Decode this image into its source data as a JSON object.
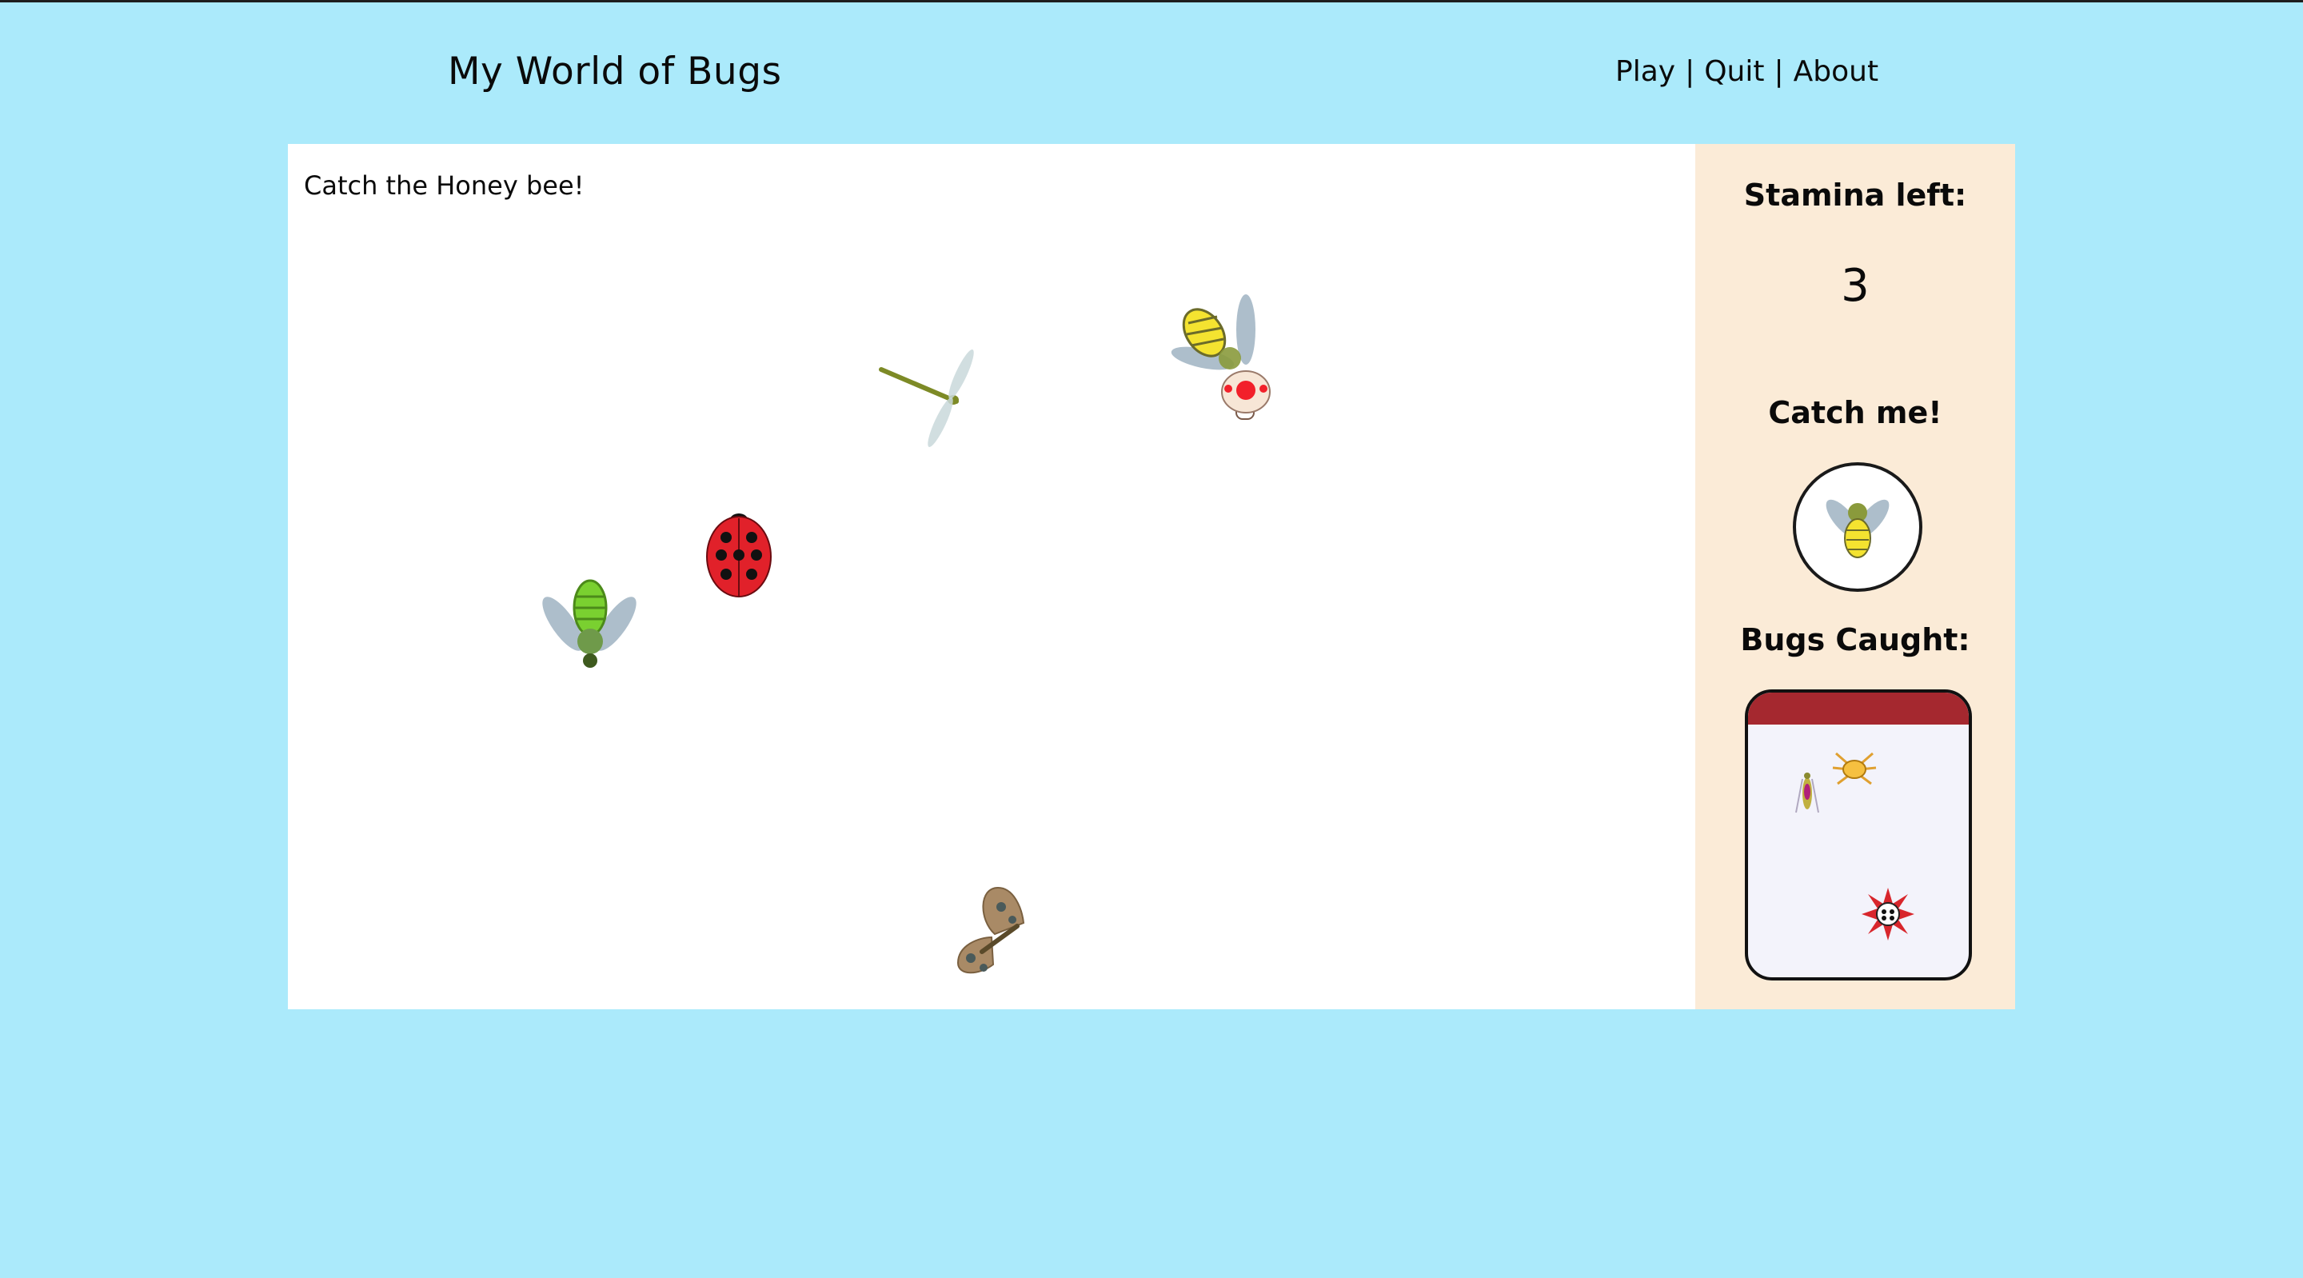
{
  "header": {
    "title": "My World of Bugs",
    "nav": [
      {
        "label": "Play"
      },
      {
        "label": "Quit"
      },
      {
        "label": "About"
      }
    ],
    "separator": "|"
  },
  "game": {
    "instruction": "Catch the Honey bee!",
    "bugs": [
      {
        "name": "dragonfly-icon"
      },
      {
        "name": "honey-bee-icon"
      },
      {
        "name": "mushroom-icon"
      },
      {
        "name": "ladybug-icon"
      },
      {
        "name": "green-fly-icon"
      },
      {
        "name": "butterfly-icon"
      }
    ]
  },
  "side": {
    "stamina_label": "Stamina left:",
    "stamina_value": "3",
    "catch_label": "Catch me!",
    "target_icon": "honey-bee-icon",
    "caught_label": "Bugs Caught:",
    "caught_icons": [
      "grasshopper-icon",
      "spider-icon",
      "spiky-bug-icon"
    ]
  },
  "colors": {
    "background": "#abeafb",
    "panel": "#fbebd7",
    "jar_lid": "#a5282f",
    "jar": "#f3f3fb"
  }
}
